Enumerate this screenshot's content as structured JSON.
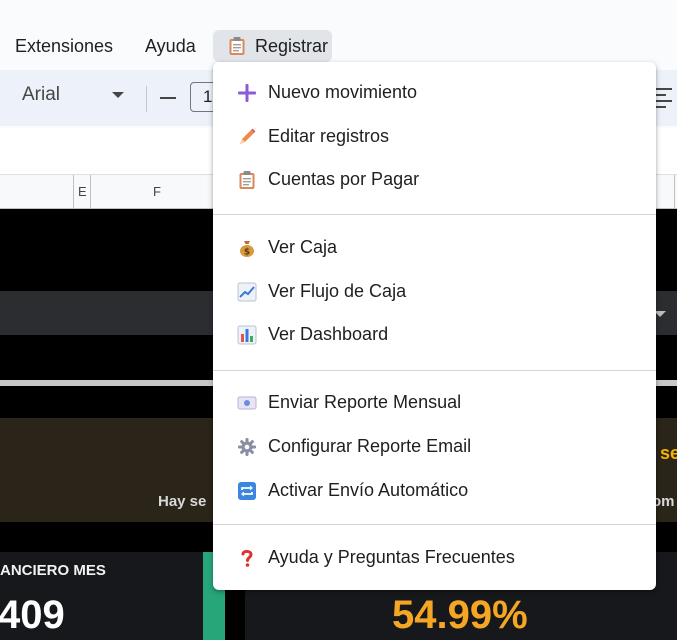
{
  "menubar": {
    "items": [
      "Extensiones",
      "Ayuda",
      "Registrar"
    ],
    "active_icon": "clipboard-icon"
  },
  "toolbar": {
    "font": "Arial",
    "font_size": "1"
  },
  "columns": [
    "E",
    "F"
  ],
  "sheet": {
    "banner_right_text": "r se",
    "banner_sub_left": "Hay se",
    "banner_sub_right": "om",
    "card_title": "ANCIERO MES",
    "card_value": "409",
    "percent_value": "54.99%"
  },
  "dropdown": {
    "groups": [
      [
        {
          "label": "Nuevo movimiento",
          "icon": "plus-icon"
        },
        {
          "label": "Editar registros",
          "icon": "pencil-icon"
        },
        {
          "label": "Cuentas por Pagar",
          "icon": "clipboard-icon"
        }
      ],
      [
        {
          "label": "Ver Caja",
          "icon": "money-bag-icon"
        },
        {
          "label": "Ver Flujo de Caja",
          "icon": "chart-increasing-icon"
        },
        {
          "label": "Ver Dashboard",
          "icon": "bar-chart-icon"
        }
      ],
      [
        {
          "label": "Enviar Reporte Mensual",
          "icon": "email-icon"
        },
        {
          "label": "Configurar Reporte Email",
          "icon": "gear-icon"
        },
        {
          "label": "Activar Envío Automático",
          "icon": "repeat-icon"
        }
      ],
      [
        {
          "label": "Ayuda y Preguntas Frecuentes",
          "icon": "question-icon"
        }
      ]
    ]
  },
  "colors": {
    "accent_orange": "#f5a623",
    "accent_green": "#27a67a",
    "menu_active_bg": "#e1e5ea"
  }
}
